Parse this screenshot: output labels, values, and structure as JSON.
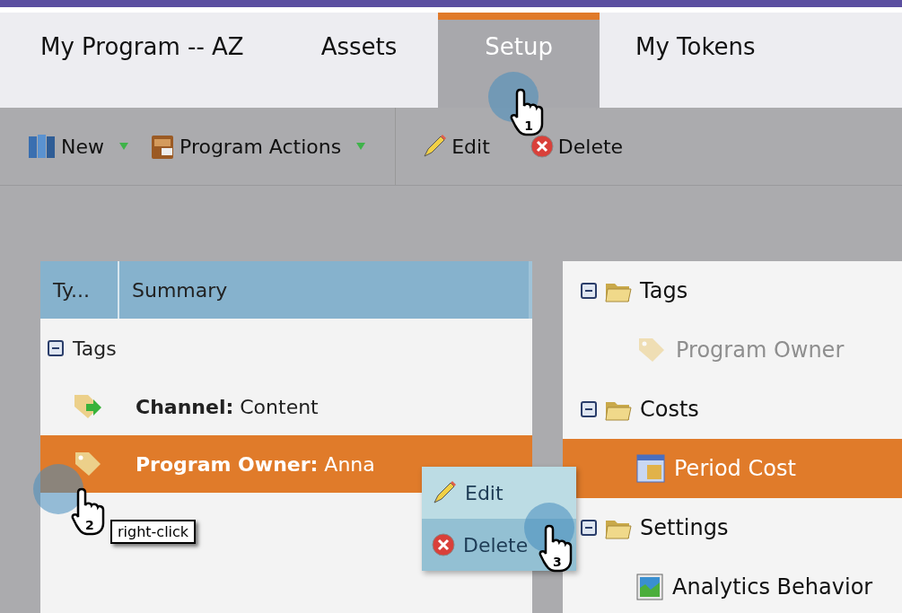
{
  "tabs": [
    {
      "label": "My Program -- AZ",
      "selected": false
    },
    {
      "label": "Assets",
      "selected": false
    },
    {
      "label": "Setup",
      "selected": true
    },
    {
      "label": "My Tokens",
      "selected": false
    }
  ],
  "toolbar": [
    {
      "label": "New",
      "kind": "dropdown"
    },
    {
      "label": "Program Actions",
      "kind": "dropdown"
    },
    {
      "label": "Edit",
      "kind": "button"
    },
    {
      "label": "Delete",
      "kind": "button"
    }
  ],
  "left_table": {
    "columns": [
      "Ty...",
      "Summary"
    ],
    "groups": [
      {
        "label": "Tags",
        "expanded": true,
        "rows": [
          {
            "kind": "channel",
            "text": "**Channel:** Content",
            "selected": false
          },
          {
            "kind": "tag",
            "text": "**Program Owner:** Anna",
            "selected": true
          }
        ]
      }
    ]
  },
  "context_menu": [
    {
      "label": "Edit",
      "kind": "edit",
      "selected": false
    },
    {
      "label": "Delete",
      "kind": "delete",
      "selected": true
    }
  ],
  "right_tree": [
    {
      "label": "Tags",
      "expanded": true,
      "children": [
        {
          "label": "Program Owner",
          "kind": "tag",
          "disabled": true,
          "selected": false
        }
      ]
    },
    {
      "label": "Costs",
      "expanded": true,
      "children": [
        {
          "label": "Period Cost",
          "kind": "cost",
          "disabled": false,
          "selected": true
        }
      ]
    },
    {
      "label": "Settings",
      "expanded": true,
      "children": [
        {
          "label": "Analytics Behavior",
          "kind": "analytics",
          "disabled": false,
          "selected": false
        }
      ]
    }
  ],
  "callouts": [
    {
      "number": "1"
    },
    {
      "number": "2",
      "label": "right-click"
    },
    {
      "number": "3"
    }
  ]
}
